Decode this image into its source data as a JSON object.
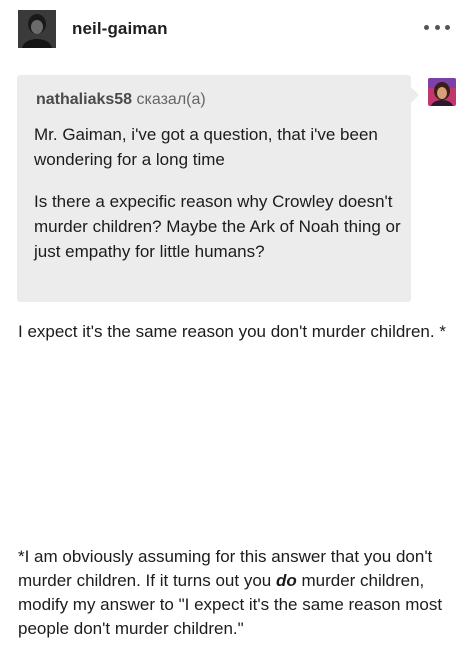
{
  "post": {
    "blog_name": "neil-gaiman",
    "more_icon": "more-horizontal-icon"
  },
  "ask": {
    "asker_name": "nathaliaks58",
    "asker_said": " сказал(а)",
    "question_p1": "Mr. Gaiman, i've got a question, that i've been wondering for a long time",
    "question_p2": "Is there a expecific reason why Crowley doesn't murder children? Maybe the Ark of Noah thing or just empathy for little humans?"
  },
  "answer": {
    "p1": "I expect it's the same reason you don't murder children. *",
    "p2_before": "*I am obviously assuming for this answer that you don't murder children. If it turns out you ",
    "p2_emph": "do",
    "p2_after": " murder children, modify my answer to \"I expect it's the same reason most people don't murder children.\""
  },
  "colors": {
    "ask_background": "#ececec",
    "text": "#1c1c1c",
    "asker_avatar_bg": "#c2366e"
  }
}
